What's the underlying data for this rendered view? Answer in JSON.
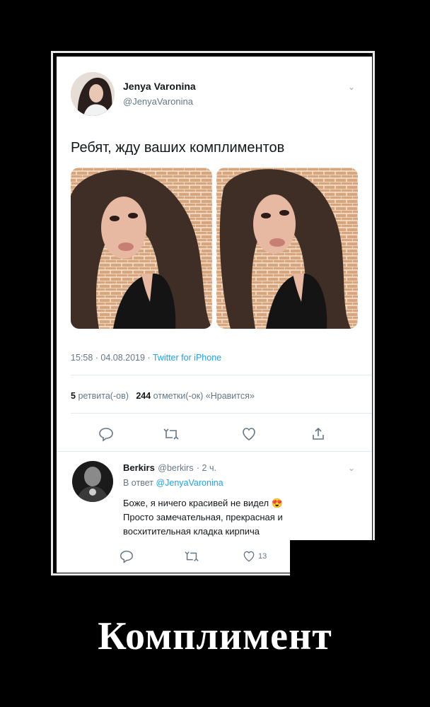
{
  "tweet": {
    "author_name": "Jenya Varonina",
    "author_handle": "@JenyaVaronina",
    "text": "Ребят, жду ваших комплиментов",
    "timestamp": "15:58 · 04.08.2019 · ",
    "source": "Twitter for iPhone",
    "retweets_count": "5",
    "retweets_label": "ретвита(-ов)",
    "likes_count": "244",
    "likes_label": "отметки(-ок) «Нравится»"
  },
  "reply": {
    "author_name": "Berkirs",
    "author_handle": "@berkirs",
    "time": "· 2 ч.",
    "reply_to_prefix": "В ответ",
    "reply_to_handle": "@JenyaVaronina",
    "line1": "Боже, я ничего красивей не видел",
    "emoji": "😍",
    "line2": "Просто замечательная, прекрасная и",
    "line3": "восхитительная кладка кирпича",
    "like_count": "13"
  },
  "caption": "Комплимент",
  "colors": {
    "link": "#1da1f2",
    "muted": "#657786",
    "text": "#14171a"
  }
}
